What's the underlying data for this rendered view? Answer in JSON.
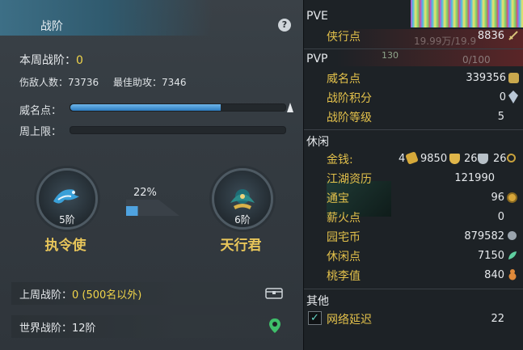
{
  "left": {
    "tab_title": "战阶",
    "help_label": "?",
    "week_rank_label": "本周战阶：",
    "week_rank_value": "0",
    "damage_count": "伤敌人数：73736",
    "best_assist": "最佳助攻：7346",
    "prestige_label": "威名点：",
    "prestige_progress": 0.7,
    "weekly_cap_label": "周上限：",
    "weekly_cap_progress": 0,
    "current_rank": {
      "level": "5阶",
      "name": "执令使"
    },
    "next_rank": {
      "level": "6阶",
      "name": "天行君"
    },
    "rank_progress_text": "22%",
    "rank_progress": 0.22,
    "last_week_label": "上周战阶：",
    "last_week_value": "0 (500名以外)",
    "world_rank_label": "世界战阶：",
    "world_rank_value": "12阶"
  },
  "right": {
    "pve": {
      "header": "PVE",
      "items": [
        {
          "label": "侠行点",
          "value": "8836",
          "icon": "sword-icon"
        }
      ]
    },
    "pvp": {
      "header": "PVP",
      "items": [
        {
          "label": "威名点",
          "value": "339356",
          "icon": "badge-icon"
        },
        {
          "label": "战阶积分",
          "value": "0",
          "icon": "crystal-icon"
        },
        {
          "label": "战阶等级",
          "value": "5"
        }
      ]
    },
    "leisure": {
      "header": "休闲",
      "money": {
        "label": "金钱:",
        "gold": "4",
        "silver": "9850",
        "copper1": "26",
        "copper2": "26"
      },
      "items": [
        {
          "label": "江湖资历",
          "value": "121990"
        },
        {
          "label": "通宝",
          "value": "96",
          "icon": "coin-icon"
        },
        {
          "label": "薪火点",
          "value": "0"
        },
        {
          "label": "园宅币",
          "value": "879582",
          "icon": "g-coin-icon"
        },
        {
          "label": "休闲点",
          "value": "7150",
          "icon": "leaf-icon"
        },
        {
          "label": "桃李值",
          "value": "840",
          "icon": "gourd-icon"
        }
      ]
    },
    "other": {
      "header": "其他",
      "net_label": "网络延迟",
      "net_value": "22",
      "net_checked": "✓"
    },
    "overlay": {
      "top_value": "19.99万/19.9",
      "level_badge": "130",
      "ratio": "0/100"
    }
  },
  "colors": {
    "accent_yellow": "#f1d54a",
    "label_gold": "#e3c14b",
    "rank_name": "#e7c55a",
    "bar_blue": "#2d7cc0"
  }
}
